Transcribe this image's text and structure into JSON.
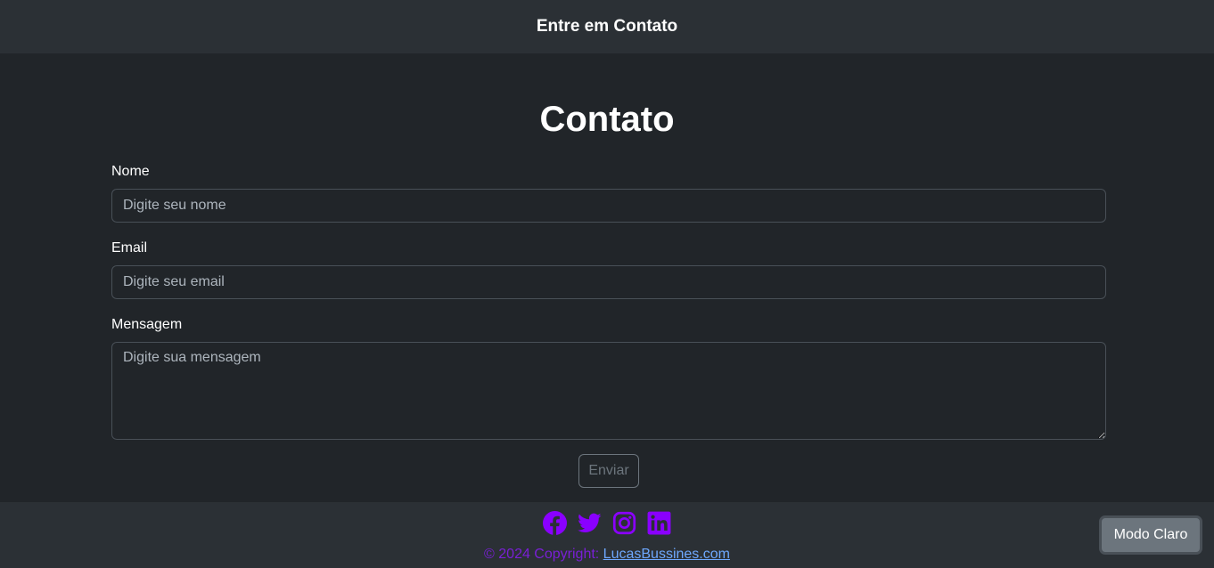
{
  "header": {
    "title": "Entre em Contato"
  },
  "page": {
    "heading": "Contato"
  },
  "form": {
    "name_label": "Nome",
    "name_placeholder": "Digite seu nome",
    "email_label": "Email",
    "email_placeholder": "Digite seu email",
    "message_label": "Mensagem",
    "message_placeholder": "Digite sua mensagem",
    "submit_label": "Enviar"
  },
  "footer": {
    "social_icons": [
      "facebook-icon",
      "twitter-icon",
      "instagram-icon",
      "linkedin-icon"
    ],
    "icon_color": "#8a00ff",
    "copyright_text": "© 2024 Copyright: ",
    "copyright_link": "LucasBussines.com"
  },
  "theme_toggle": {
    "label": "Modo Claro"
  },
  "colors": {
    "background": "#212529",
    "header_footer": "#2b3035",
    "accent_purple": "#8a00ff",
    "link": "#6ea8fe"
  }
}
